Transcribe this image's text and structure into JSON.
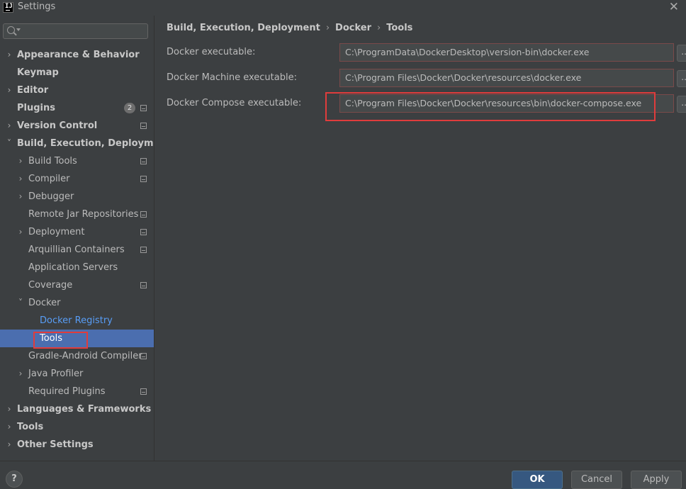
{
  "window": {
    "app_icon_text": "IJ",
    "title": "Settings",
    "close_glyph": "✕"
  },
  "search": {
    "value": ""
  },
  "sidebar": {
    "items": [
      {
        "label": "Appearance & Behavior",
        "bold": true,
        "arrow": "›",
        "level": 0
      },
      {
        "label": "Keymap",
        "bold": true,
        "level": 0
      },
      {
        "label": "Editor",
        "bold": true,
        "arrow": "›",
        "level": 0
      },
      {
        "label": "Plugins",
        "bold": true,
        "level": 0,
        "badge": "2",
        "proj": true
      },
      {
        "label": "Version Control",
        "bold": true,
        "arrow": "›",
        "level": 0,
        "proj": true
      },
      {
        "label": "Build, Execution, Deployment",
        "bold": true,
        "arrow": "˅",
        "level": 0
      },
      {
        "label": "Build Tools",
        "arrow": "›",
        "level": 1,
        "proj": true
      },
      {
        "label": "Compiler",
        "arrow": "›",
        "level": 1,
        "proj": true
      },
      {
        "label": "Debugger",
        "arrow": "›",
        "level": 1
      },
      {
        "label": "Remote Jar Repositories",
        "level": 1,
        "proj": true
      },
      {
        "label": "Deployment",
        "arrow": "›",
        "level": 1,
        "proj": true
      },
      {
        "label": "Arquillian Containers",
        "level": 1,
        "proj": true
      },
      {
        "label": "Application Servers",
        "level": 1
      },
      {
        "label": "Coverage",
        "level": 1,
        "proj": true
      },
      {
        "label": "Docker",
        "arrow": "˅",
        "level": 1
      },
      {
        "label": "Docker Registry",
        "level": 2,
        "link": true
      },
      {
        "label": "Tools",
        "level": 2,
        "selected": true
      },
      {
        "label": "Gradle-Android Compiler",
        "level": 1,
        "proj": true
      },
      {
        "label": "Java Profiler",
        "arrow": "›",
        "level": 1
      },
      {
        "label": "Required Plugins",
        "level": 1,
        "proj": true
      },
      {
        "label": "Languages & Frameworks",
        "bold": true,
        "arrow": "›",
        "level": 0
      },
      {
        "label": "Tools",
        "bold": true,
        "arrow": "›",
        "level": 0
      },
      {
        "label": "Other Settings",
        "bold": true,
        "arrow": "›",
        "level": 0
      }
    ]
  },
  "breadcrumb": {
    "parts": [
      "Build, Execution, Deployment",
      "Docker",
      "Tools"
    ],
    "separator": "›"
  },
  "fields": [
    {
      "label": "Docker executable:",
      "value": "C:\\ProgramData\\DockerDesktop\\version-bin\\docker.exe",
      "browse": "..."
    },
    {
      "label": "Docker Machine executable:",
      "value": "C:\\Program Files\\Docker\\Docker\\resources\\docker.exe",
      "browse": "..."
    },
    {
      "label": "Docker Compose executable:",
      "value": "C:\\Program Files\\Docker\\Docker\\resources\\bin\\docker-compose.exe",
      "browse": "..."
    }
  ],
  "footer": {
    "help": "?",
    "ok": "OK",
    "cancel": "Cancel",
    "apply": "Apply"
  },
  "colors": {
    "background": "#3c3f41",
    "selection": "#4b6eaf",
    "link": "#589df6",
    "ok_button": "#365880",
    "highlight_box": "#e03c3c"
  }
}
